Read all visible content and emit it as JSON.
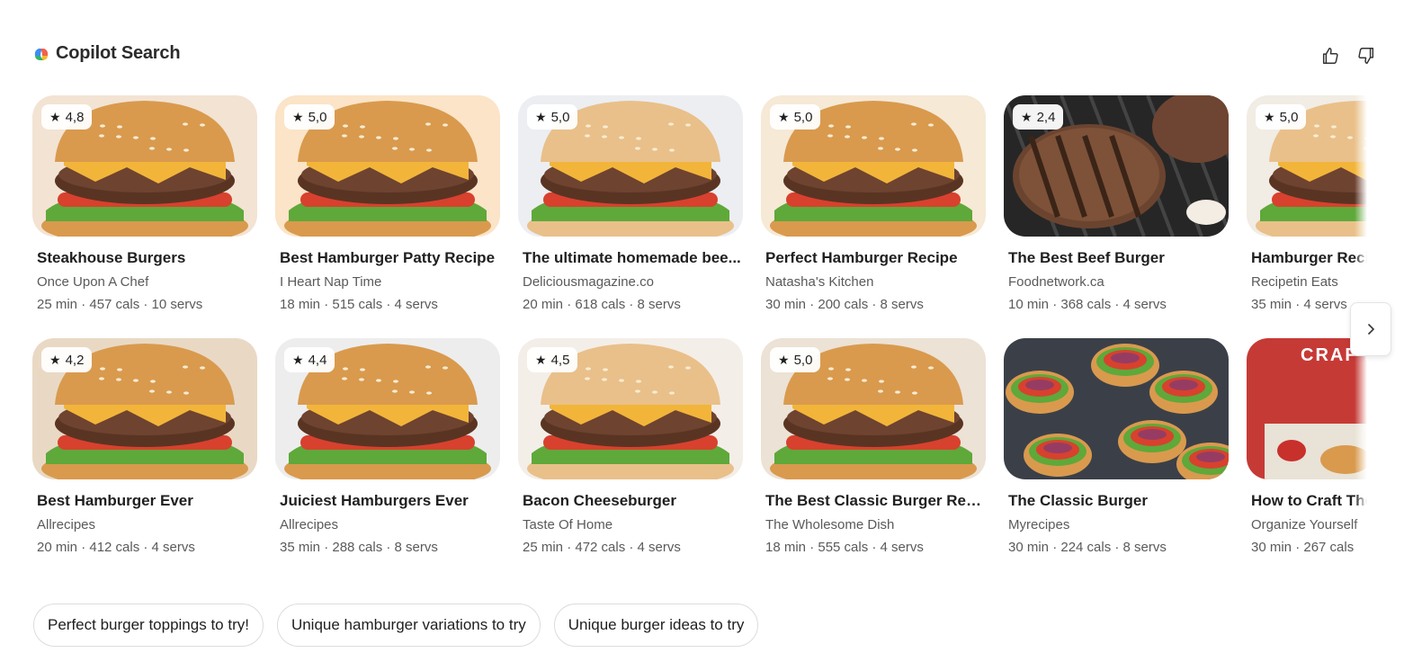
{
  "brand": {
    "title": "Copilot Search",
    "logo_icon": "copilot-logo-icon"
  },
  "feedback": {
    "like_icon": "thumbs-up-icon",
    "dislike_icon": "thumbs-down-icon"
  },
  "recipes_row1": [
    {
      "rating": "4,8",
      "title": "Steakhouse Burgers",
      "source": "Once Upon A Chef",
      "meta": "25 min · 457 cals · 10 servs"
    },
    {
      "rating": "5,0",
      "title": "Best Hamburger Patty Recipe",
      "source": "I Heart Nap Time",
      "meta": "18 min · 515 cals · 4 servs"
    },
    {
      "rating": "5,0",
      "title": "The ultimate homemade bee...",
      "source": "Deliciousmagazine.co",
      "meta": "20 min · 618 cals · 8 servs"
    },
    {
      "rating": "5,0",
      "title": "Perfect Hamburger Recipe",
      "source": "Natasha's Kitchen",
      "meta": "30 min · 200 cals · 8 servs"
    },
    {
      "rating": "2,4",
      "title": "The Best Beef Burger",
      "source": "Foodnetwork.ca",
      "meta": "10 min · 368 cals · 4 servs"
    },
    {
      "rating": "5,0",
      "title": "Hamburger Reci",
      "source": "Recipetin Eats",
      "meta": "35 min · 4 servs"
    }
  ],
  "recipes_row2": [
    {
      "rating": "4,2",
      "title": "Best Hamburger Ever",
      "source": "Allrecipes",
      "meta": "20 min · 412 cals · 4 servs"
    },
    {
      "rating": "4,4",
      "title": "Juiciest Hamburgers Ever",
      "source": "Allrecipes",
      "meta": "35 min · 288 cals · 8 servs"
    },
    {
      "rating": "4,5",
      "title": "Bacon Cheeseburger",
      "source": "Taste Of Home",
      "meta": "25 min · 472 cals · 4 servs"
    },
    {
      "rating": "5,0",
      "title": "The Best Classic Burger Rec...",
      "source": "The Wholesome Dish",
      "meta": "18 min · 555 cals · 4 servs"
    },
    {
      "rating": "",
      "title": "The Classic Burger",
      "source": "Myrecipes",
      "meta": "30 min · 224 cals · 8 servs"
    },
    {
      "rating": "",
      "title": "How to Craft The",
      "source": "Organize Yourself",
      "meta": "30 min · 267 cals",
      "image_text": "CRAF MOST DE HEAL BURGER"
    }
  ],
  "next_button_icon": "chevron-right-icon",
  "suggestions": [
    "Perfect burger toppings to try!",
    "Unique hamburger variations to try",
    "Unique burger ideas to try"
  ],
  "colors": {
    "bun": "#d99a4e",
    "patty": "#5a3423",
    "lettuce": "#5fa83a",
    "tomato": "#d8412e",
    "cheese": "#f2b53a"
  }
}
